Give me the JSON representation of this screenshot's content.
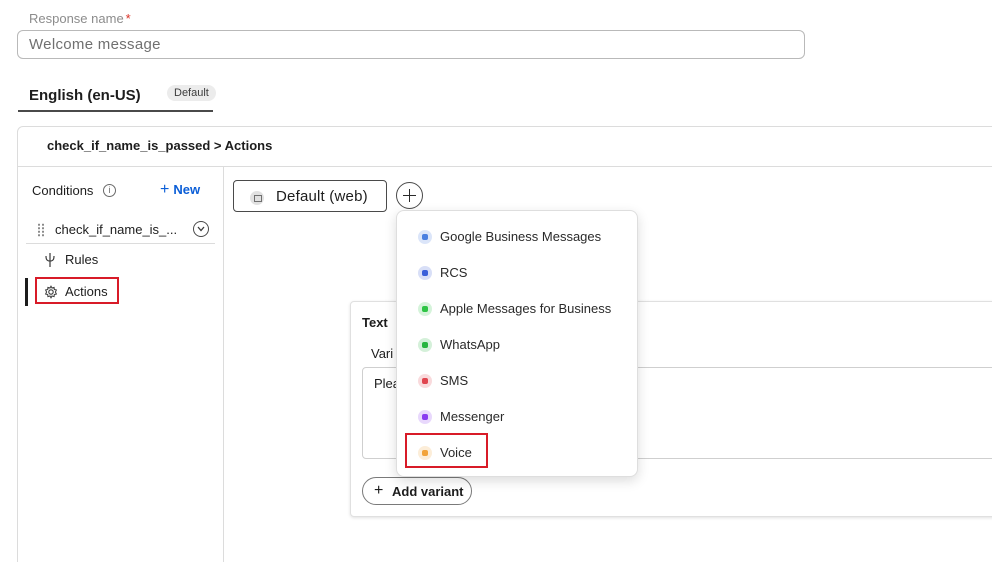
{
  "form": {
    "name_label": "Response name",
    "required_mark": "*",
    "name_value": "Welcome message"
  },
  "language_tab": {
    "label": "English (en-US)",
    "badge": "Default"
  },
  "breadcrumb": "check_if_name_is_passed > Actions",
  "sidebar": {
    "conditions_label": "Conditions",
    "new_label": "New",
    "condition_item": "check_if_name_is_...",
    "rules_label": "Rules",
    "actions_label": "Actions"
  },
  "channel": {
    "active_label": "Default (web)"
  },
  "text_card": {
    "title": "Text",
    "variant_label": "Vari",
    "text_value": "Plea",
    "add_variant_label": "Add variant"
  },
  "channel_menu": {
    "items": [
      {
        "label": "Google Business Messages",
        "icon": "google-business-messages-icon",
        "color": "#4a7fe0"
      },
      {
        "label": "RCS",
        "icon": "rcs-icon",
        "color": "#3a5fd9"
      },
      {
        "label": "Apple Messages for Business",
        "icon": "apple-messages-icon",
        "color": "#2ec445"
      },
      {
        "label": "WhatsApp",
        "icon": "whatsapp-icon",
        "color": "#27b53f"
      },
      {
        "label": "SMS",
        "icon": "sms-icon",
        "color": "#e0454f"
      },
      {
        "label": "Messenger",
        "icon": "messenger-icon",
        "color": "#8a3cf0"
      },
      {
        "label": "Voice",
        "icon": "voice-icon",
        "color": "#f2a33a"
      }
    ]
  },
  "colors": {
    "accent_link": "#0b5ed7",
    "highlight_border": "#d81b28"
  }
}
